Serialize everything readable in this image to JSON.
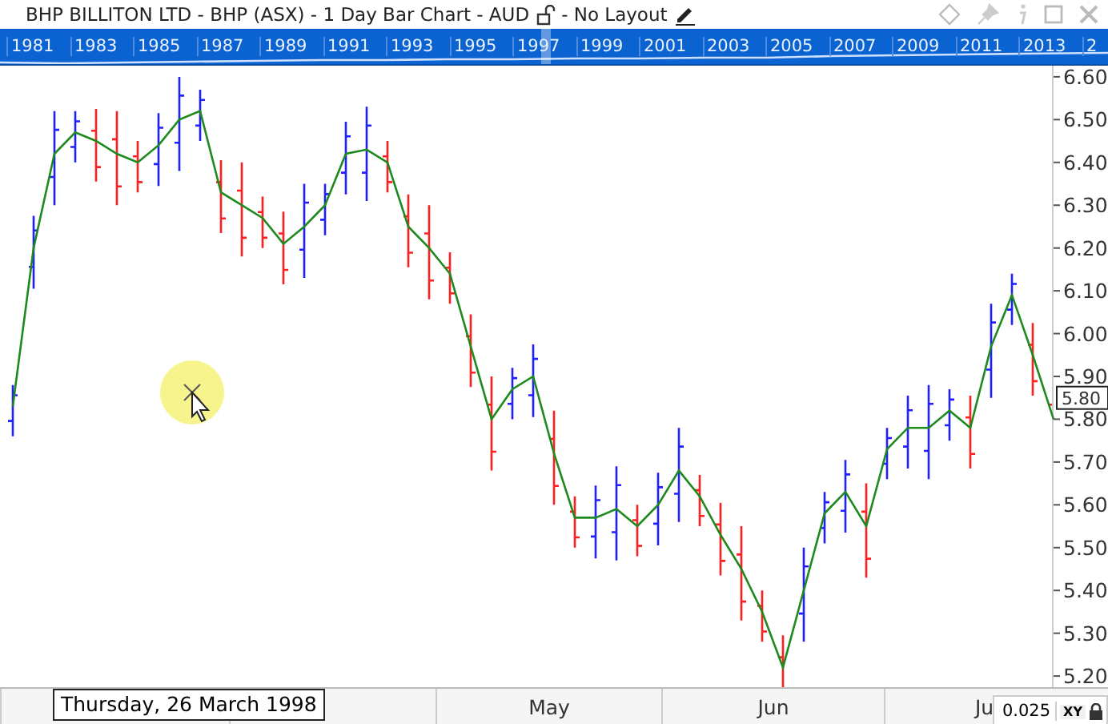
{
  "window": {
    "title": "BHP BILLITON LTD - BHP (ASX) - 1 Day Bar Chart - AUD",
    "layout": "- No Layout"
  },
  "navigator": {
    "years": [
      "1981",
      "1983",
      "1985",
      "1987",
      "1989",
      "1991",
      "1993",
      "1995",
      "1997",
      "1999",
      "2001",
      "2003",
      "2005",
      "2007",
      "2009",
      "2011",
      "2013",
      "2"
    ]
  },
  "chart": {
    "chart_data": {
      "type": "line",
      "ylim": [
        5.174,
        6.626
      ],
      "yticks": [
        {
          "value": 6.6,
          "label": "6.60"
        },
        {
          "value": 6.5,
          "label": "6.50"
        },
        {
          "value": 6.4,
          "label": "6.40"
        },
        {
          "value": 6.3,
          "label": "6.30"
        },
        {
          "value": 6.2,
          "label": "6.20"
        },
        {
          "value": 6.1,
          "label": "6.10"
        },
        {
          "value": 6.0,
          "label": "6.00"
        },
        {
          "value": 5.9,
          "label": "5.90"
        },
        {
          "value": 5.8,
          "label": "5.80"
        },
        {
          "value": 5.7,
          "label": "5.70"
        },
        {
          "value": 5.6,
          "label": "5.60"
        },
        {
          "value": 5.5,
          "label": "5.50"
        },
        {
          "value": 5.4,
          "label": "5.40"
        },
        {
          "value": 5.3,
          "label": "5.30"
        },
        {
          "value": 5.2,
          "label": "5.20"
        }
      ],
      "series": [
        {
          "color": "#1e8a1e",
          "values": [
            5.83,
            6.2,
            6.42,
            6.47,
            6.45,
            6.42,
            6.4,
            6.44,
            6.5,
            6.52,
            6.33,
            6.3,
            6.27,
            6.21,
            6.25,
            6.3,
            6.42,
            6.43,
            6.4,
            6.25,
            6.2,
            6.14,
            5.97,
            5.8,
            5.87,
            5.9,
            5.72,
            5.57,
            5.57,
            5.59,
            5.55,
            5.6,
            5.68,
            5.62,
            5.53,
            5.45,
            5.35,
            5.22,
            5.4,
            5.58,
            5.63,
            5.55,
            5.73,
            5.78,
            5.78,
            5.82,
            5.78,
            5.97,
            6.09,
            5.95,
            5.8
          ]
        }
      ]
    },
    "current_price": "5.80"
  },
  "x_axis": {
    "months": [
      "May",
      "Jun",
      "Ju"
    ]
  },
  "tooltip": "Thursday, 26 March 1998",
  "scale_value": "0.025",
  "scale_mode": "XY"
}
